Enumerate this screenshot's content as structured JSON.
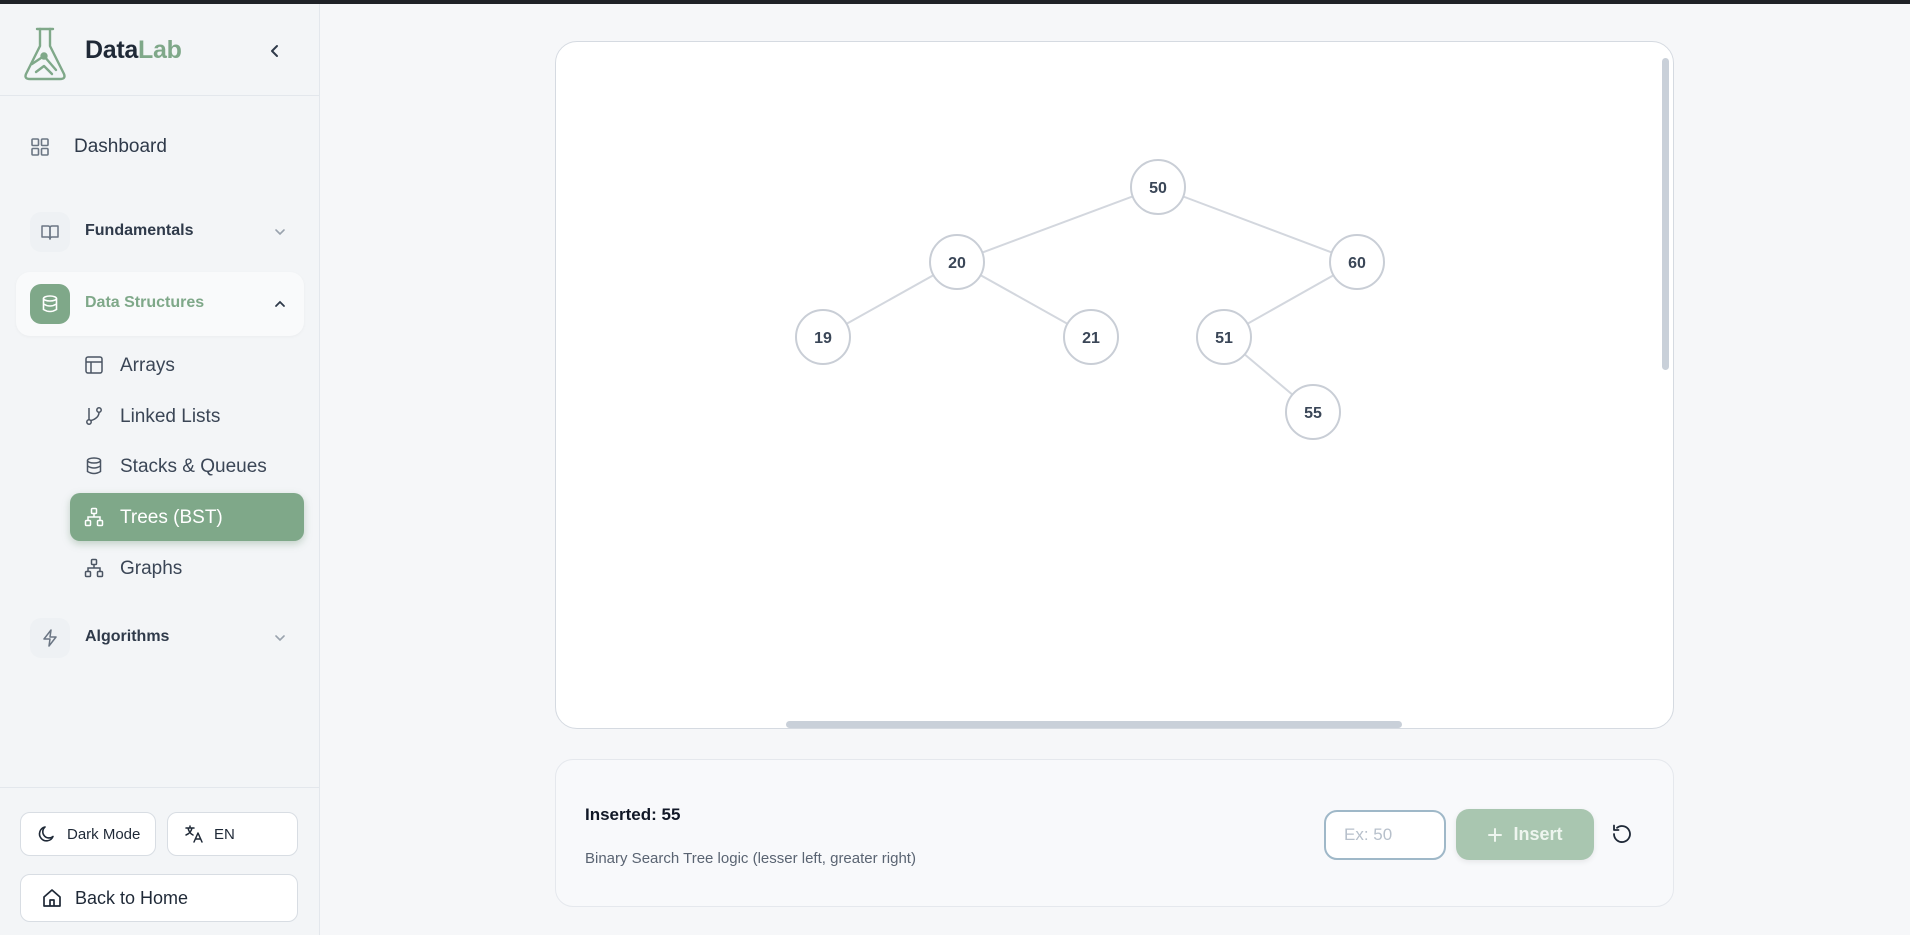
{
  "app": {
    "brand_part1": "Data",
    "brand_part2": "Lab",
    "accent_color": "#7fa889"
  },
  "sidebar": {
    "dashboard": "Dashboard",
    "groups": [
      {
        "label": "Fundamentals",
        "icon": "book-icon",
        "expanded": false
      },
      {
        "label": "Data Structures",
        "icon": "database-icon",
        "expanded": true
      },
      {
        "label": "Algorithms",
        "icon": "lightning-icon",
        "expanded": false
      }
    ],
    "data_structures_items": [
      {
        "label": "Arrays",
        "icon": "table-icon"
      },
      {
        "label": "Linked Lists",
        "icon": "git-branch-icon"
      },
      {
        "label": "Stacks & Queues",
        "icon": "database-icon"
      },
      {
        "label": "Trees (BST)",
        "icon": "tree-network-icon",
        "active": true
      },
      {
        "label": "Graphs",
        "icon": "tree-network-icon"
      }
    ],
    "dark_mode": "Dark Mode",
    "language": "EN",
    "back_home": "Back to Home"
  },
  "tree": {
    "nodes": [
      "50",
      "20",
      "60",
      "19",
      "21",
      "51",
      "55"
    ],
    "edges": [
      [
        "50",
        "20"
      ],
      [
        "50",
        "60"
      ],
      [
        "20",
        "19"
      ],
      [
        "20",
        "21"
      ],
      [
        "60",
        "51"
      ],
      [
        "51",
        "55"
      ]
    ]
  },
  "panel": {
    "status": "Inserted: 55",
    "description": "Binary Search Tree logic (lesser left, greater right)",
    "input_placeholder": "Ex: 50",
    "input_value": "",
    "insert_label": "Insert"
  }
}
